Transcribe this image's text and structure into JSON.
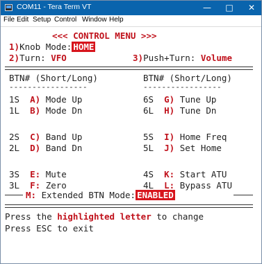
{
  "titlebar": {
    "title": "COM11 - Tera Term VT",
    "icons": {
      "app": "terminal-icon",
      "minimize": "minimize-icon",
      "maximize": "maximize-icon",
      "close": "close-icon"
    },
    "min_glyph": "—",
    "max_glyph": "□",
    "close_glyph": "✕",
    "color": "#0a64ad"
  },
  "menu": [
    "File",
    "Edit",
    "Setup",
    "Control",
    "Window",
    "Help"
  ],
  "terminal": {
    "header": "<<< CONTROL MENU >>>",
    "row1": {
      "num": "1)",
      "label": "Knob Mode:",
      "value": "HOME"
    },
    "row2": {
      "num": "2)",
      "label": "Turn:",
      "value": "VFO"
    },
    "row3": {
      "num": "3)",
      "label": "Push+Turn:",
      "value": "Volume"
    },
    "col_header_left": "BTN# (Short/Long)",
    "col_header_right": "BTN# (Short/Long)",
    "dash_left": "-----------------",
    "dash_right": "-----------------",
    "buttons": [
      {
        "code": "1S",
        "key": "A)",
        "label": "Mode Up",
        "code2": "6S",
        "key2": "G)",
        "label2": "Tune Up"
      },
      {
        "code": "1L",
        "key": "B)",
        "label": "Mode Dn",
        "code2": "6L",
        "key2": "H)",
        "label2": "Tune Dn"
      },
      {
        "code": "2S",
        "key": "C)",
        "label": "Band Up",
        "code2": "5S",
        "key2": "I)",
        "label2": "Home Freq"
      },
      {
        "code": "2L",
        "key": "D)",
        "label": "Band Dn",
        "code2": "5L",
        "key2": "J)",
        "label2": "Set Home"
      },
      {
        "code": "3S",
        "key": "E:",
        "label": "Mute",
        "code2": "4S",
        "key2": "K:",
        "label2": "Start ATU"
      },
      {
        "code": "3L",
        "key": "F:",
        "label": "Zero",
        "code2": "4L",
        "key2": "L:",
        "label2": "Bypass ATU"
      }
    ],
    "ext": {
      "key": "M:",
      "label": "Extended BTN Mode:",
      "value": "ENABLED"
    },
    "footer": {
      "pre": "Press the ",
      "highlight": "highlighted letter",
      "post": " to change",
      "line2": "Press ESC to exit"
    },
    "colors": {
      "accent": "#c0111b",
      "highlight_bg": "#d7141c"
    }
  }
}
